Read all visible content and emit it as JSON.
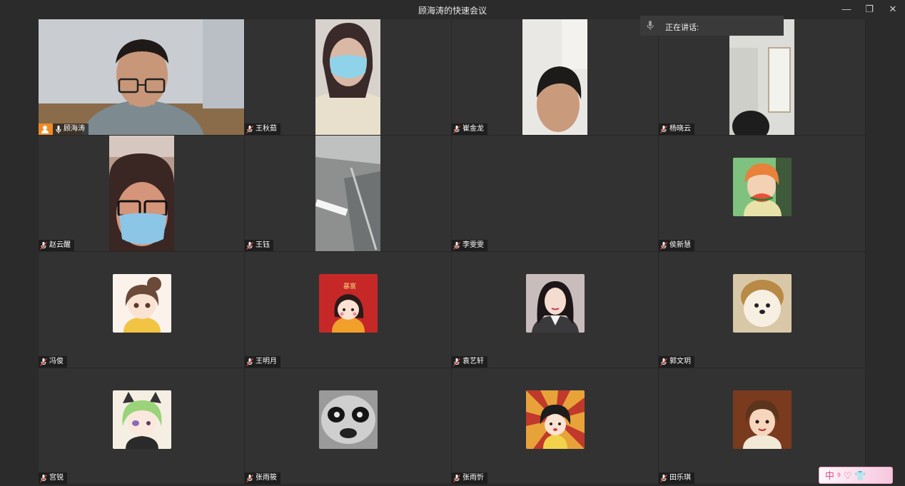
{
  "window": {
    "title": "顾海涛的快速会议",
    "controls": {
      "minimize": "—",
      "restore": "❐",
      "close": "✕"
    }
  },
  "speaking_indicator": {
    "label": "正在讲话:"
  },
  "participants": [
    {
      "name": "顾海涛",
      "kind": "video",
      "host": true
    },
    {
      "name": "王秋茹",
      "kind": "video"
    },
    {
      "name": "崔金龙",
      "kind": "video"
    },
    {
      "name": "杨晓云",
      "kind": "video"
    },
    {
      "name": "赵云醒",
      "kind": "video"
    },
    {
      "name": "王钰",
      "kind": "video"
    },
    {
      "name": "李雯雯",
      "kind": "empty"
    },
    {
      "name": "侯新慧",
      "kind": "avatar",
      "avatar": "anime-boy-watermelon"
    },
    {
      "name": "冯俊",
      "kind": "avatar",
      "avatar": "anime-girl-hairbun"
    },
    {
      "name": "王明月",
      "kind": "avatar",
      "avatar": "cartoon-girl-red"
    },
    {
      "name": "袁艺轩",
      "kind": "avatar",
      "avatar": "illustrated-woman-blazer"
    },
    {
      "name": "郭文玥",
      "kind": "avatar",
      "avatar": "fluffy-dog"
    },
    {
      "name": "宫锐",
      "kind": "avatar",
      "avatar": "green-hair-cat-ears"
    },
    {
      "name": "张雨筱",
      "kind": "avatar",
      "avatar": "panda-face"
    },
    {
      "name": "张雨忻",
      "kind": "avatar",
      "avatar": "cartoon-girl-sunburst"
    },
    {
      "name": "田乐琪",
      "kind": "avatar",
      "avatar": "anime-boy-portrait"
    }
  ],
  "ime_toolbar": {
    "label": "中 ⁹ ♡ 👕"
  },
  "colors": {
    "background": "#2b2b2b",
    "tile": "#323232",
    "host_badge": "#f08a24"
  }
}
